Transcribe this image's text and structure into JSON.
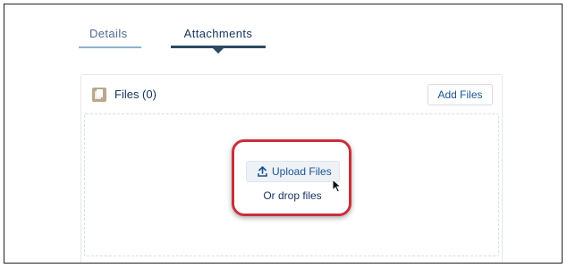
{
  "tabs": [
    {
      "label": "Details",
      "active": false
    },
    {
      "label": "Attachments",
      "active": true
    }
  ],
  "card": {
    "icon": "file-icon",
    "title": "Files (0)",
    "add_button": "Add Files"
  },
  "dropzone": {
    "upload_button": "Upload Files",
    "upload_icon": "upload-icon",
    "hint": "Or drop files",
    "highlight_color": "#c8303c"
  },
  "colors": {
    "accent": "#1a5592",
    "active_tab": "#2b4a63",
    "inactive_tab_underline": "#8bb3d1",
    "file_icon_bg": "#b9a88c"
  }
}
